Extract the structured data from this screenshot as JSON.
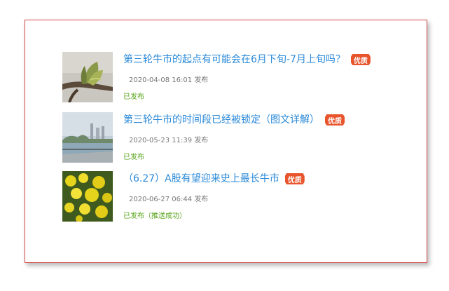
{
  "articles": [
    {
      "title": "第三轮牛市的起点有可能会在6月下旬-7月上旬吗？",
      "badge": "优质",
      "datetime": "2020-04-08 16:01",
      "action": "发布",
      "status": "已发布",
      "thumbnail": "bud-icon"
    },
    {
      "title": "第三轮牛市的时间段已经被锁定（图文详解）",
      "badge": "优质",
      "datetime": "2020-05-23 11:39",
      "action": "发布",
      "status": "已发布",
      "thumbnail": "lake-icon"
    },
    {
      "title": "（6.27）A股有望迎来史上最长牛市",
      "badge": "优质",
      "datetime": "2020-06-27 06:44",
      "action": "发布",
      "status": "已发布（推送成功）",
      "thumbnail": "yellow-flowers-icon"
    }
  ],
  "colors": {
    "title": "#2a89d8",
    "badge": "#e8552c",
    "status": "#5aa51c",
    "meta": "#777777",
    "frame_border": "#d24a4a"
  }
}
